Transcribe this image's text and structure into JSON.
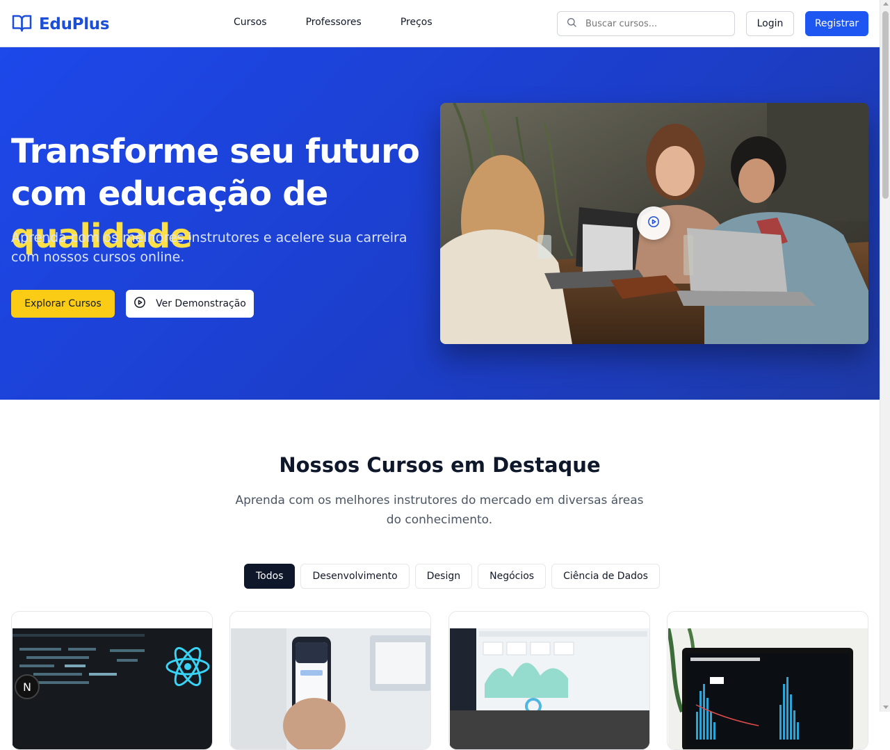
{
  "brand": {
    "name": "EduPlus",
    "color": "#1d4ed8",
    "icon": "open-book-icon"
  },
  "nav": {
    "items": [
      {
        "label": "Cursos"
      },
      {
        "label": "Professores"
      },
      {
        "label": "Preços"
      }
    ]
  },
  "search": {
    "placeholder": "Buscar cursos...",
    "icon": "search-icon"
  },
  "auth": {
    "login_label": "Login",
    "register_label": "Registrar"
  },
  "hero": {
    "title_main": "Transforme seu futuro com educação de ",
    "title_highlight": "qualidade",
    "subtitle": "Aprenda com os melhores instrutores e acelere sua carreira com nossos cursos online.",
    "explore_label": "Explorar Cursos",
    "demo_label": "Ver Demonstração",
    "accent_color": "#facc15",
    "background_color": "#1d48ea"
  },
  "featured": {
    "title": "Nossos Cursos em Destaque",
    "subtitle": "Aprenda com os melhores instrutores do mercado em diversas áreas do conhecimento.",
    "filters": [
      {
        "label": "Todos",
        "active": true
      },
      {
        "label": "Desenvolvimento",
        "active": false
      },
      {
        "label": "Design",
        "active": false
      },
      {
        "label": "Negócios",
        "active": false
      },
      {
        "label": "Ciência de Dados",
        "active": false
      }
    ]
  },
  "dev_badge": {
    "label": "N"
  }
}
